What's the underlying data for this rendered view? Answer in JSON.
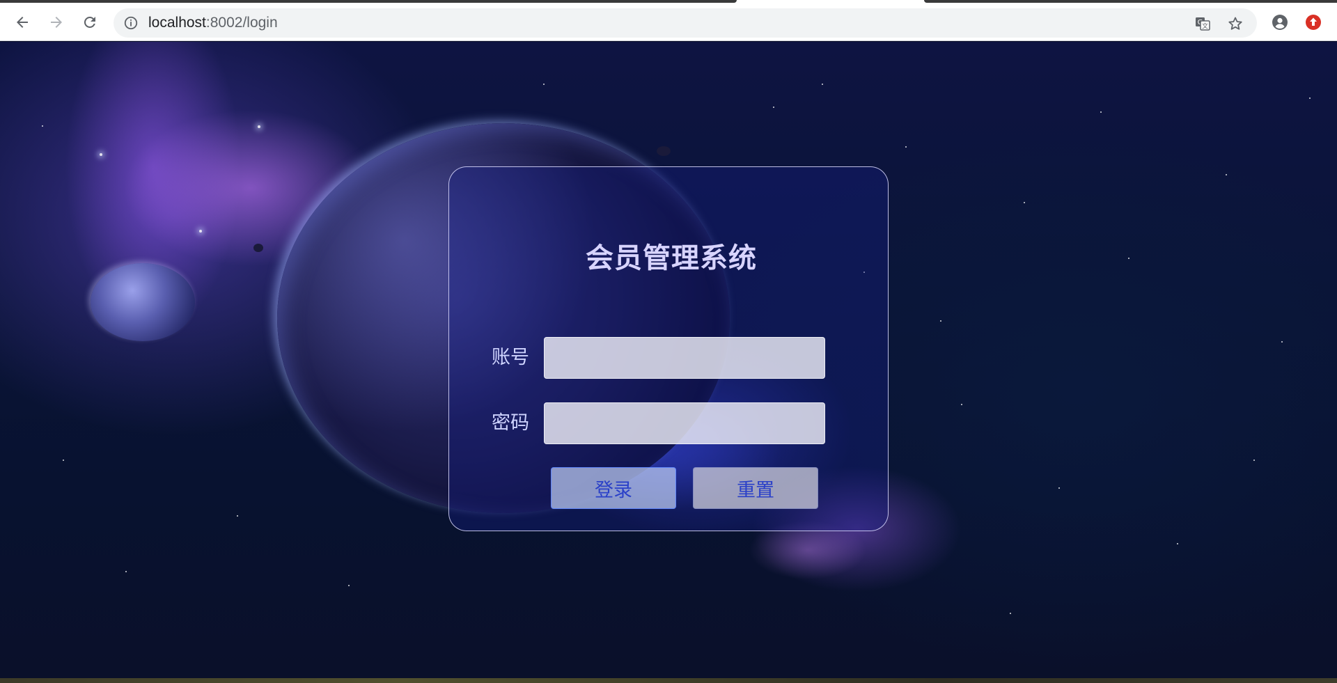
{
  "browser": {
    "url_host": "localhost",
    "url_rest": ":8002/login"
  },
  "login": {
    "title": "会员管理系统",
    "account_label": "账号",
    "account_value": "",
    "password_label": "密码",
    "password_value": "",
    "login_button": "登录",
    "reset_button": "重置"
  },
  "icons": {
    "back": "arrow-left-icon",
    "forward": "arrow-right-icon",
    "reload": "reload-icon",
    "info": "info-icon",
    "translate": "translate-icon",
    "bookmark": "star-icon",
    "profile": "account-icon",
    "update": "update-icon"
  },
  "colors": {
    "title": "#d8d4ff",
    "button_text": "#2a40c8",
    "card_border": "#dcdcff",
    "update_badge": "#d93025"
  }
}
